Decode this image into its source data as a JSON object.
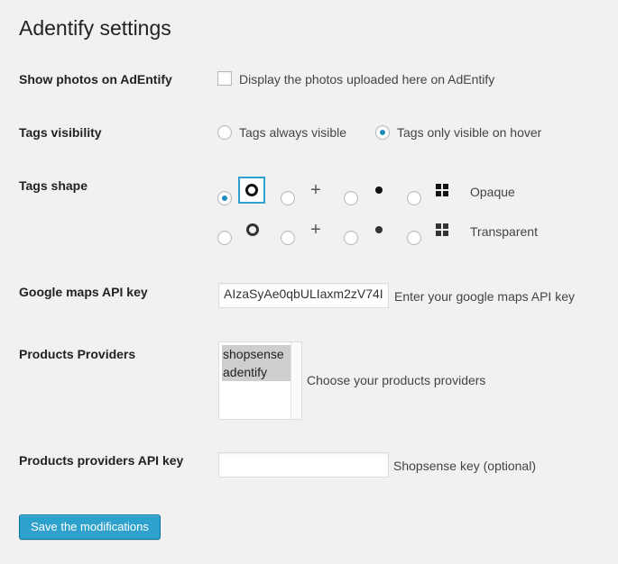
{
  "page": {
    "title": "Adentify settings"
  },
  "show_photos": {
    "label": "Show photos on AdEntify",
    "checkbox_text": "Display the photos uploaded here on AdEntify",
    "checked": false
  },
  "tags_visibility": {
    "label": "Tags visibility",
    "options": [
      {
        "text": "Tags always visible",
        "checked": false
      },
      {
        "text": "Tags only visible on hover",
        "checked": true
      }
    ]
  },
  "tags_shape": {
    "label": "Tags shape",
    "rows": [
      {
        "name": "Opaque",
        "selected_index": 0,
        "shapes": [
          "ring-icon",
          "plus-icon",
          "dot-icon",
          "grid-icon"
        ]
      },
      {
        "name": "Transparent",
        "selected_index": null,
        "shapes": [
          "ring-icon",
          "plus-icon",
          "dot-icon",
          "grid-icon"
        ]
      }
    ]
  },
  "google_maps": {
    "label": "Google maps API key",
    "value": "AIzaSyAe0qbULIaxm2zV74I",
    "hint": "Enter your google maps API key"
  },
  "products_providers": {
    "label": "Products Providers",
    "options": [
      "shopsense",
      "adentify"
    ],
    "hint": "Choose your products providers"
  },
  "providers_api_key": {
    "label": "Products providers API key",
    "value": "",
    "hint": "Shopsense key (optional)"
  },
  "actions": {
    "save_label": "Save the modifications"
  },
  "colors": {
    "accent": "#2ea2cc",
    "accent_border": "#0074a2",
    "radio_dot": "#1e8cbe",
    "background": "#f1f1f1"
  }
}
